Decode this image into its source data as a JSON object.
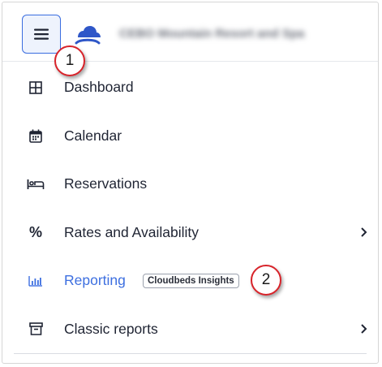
{
  "header": {
    "property_name": "CEBO Mountain Resort and Spa"
  },
  "callouts": [
    "1",
    "2"
  ],
  "nav": {
    "items": [
      {
        "label": "Dashboard",
        "icon": "dashboard-grid-icon"
      },
      {
        "label": "Calendar",
        "icon": "calendar-icon"
      },
      {
        "label": "Reservations",
        "icon": "bed-icon"
      },
      {
        "label": "Rates and Availability",
        "icon": "percent-icon",
        "has_submenu": true
      },
      {
        "label": "Reporting",
        "icon": "bar-chart-icon",
        "badge": "Cloudbeds Insights",
        "active": true
      },
      {
        "label": "Classic reports",
        "icon": "archive-box-icon",
        "has_submenu": true
      }
    ]
  },
  "colors": {
    "accent": "#3d6fe0",
    "callout_border": "#d8232a",
    "text": "#1f2433"
  }
}
